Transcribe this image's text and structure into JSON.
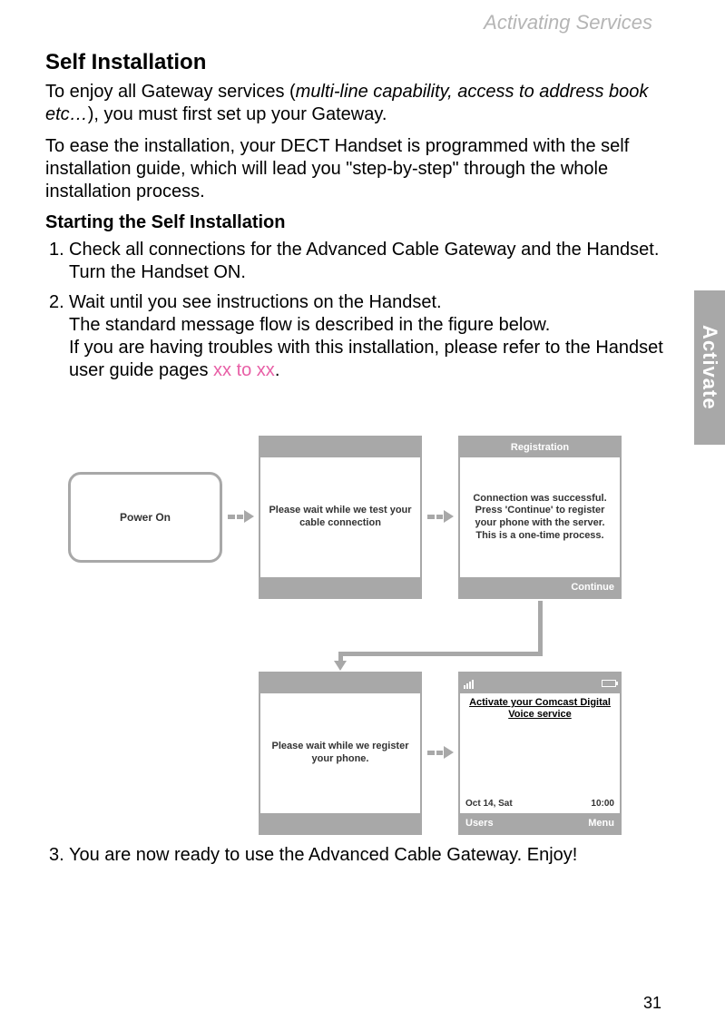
{
  "header": {
    "section_label": "Activating Services"
  },
  "side_tab": "Activate",
  "title": "Self Installation",
  "intro1_a": "To enjoy all Gateway services (",
  "intro1_b": "multi-line capability, access to address book etc…",
  "intro1_c": "), you must first set up your Gateway.",
  "intro2": "To ease the installation, your DECT Handset is programmed with the self installation guide, which will lead you \"step-by-step\" through the whole installation process.",
  "subheading": "Starting the Self Installation",
  "steps": {
    "s1": "Check all connections for the Advanced Cable Gateway and the Handset. Turn the Handset ON.",
    "s2a": "Wait until you see instructions on the Handset.",
    "s2b": "The standard message flow is described in the figure below.",
    "s2c": "If you are having troubles with this installation, please refer to the Handset user guide pages ",
    "s2d": "xx to xx",
    "s2e": ".",
    "s3": "You are now ready to use the Advanced Cable Gateway. Enjoy!"
  },
  "diagram": {
    "power_on": "Power On",
    "screen1_body": "Please wait while we test your cable connection",
    "screen2_title": "Registration",
    "screen2_body": "Connection was successful. Press 'Continue' to register your phone with the server. This is a one-time process.",
    "screen2_footer": "Continue",
    "screen3_body": "Please wait while we register your phone.",
    "screen4_activate": "Activate your Comcast Digital Voice service",
    "screen4_date": "Oct 14, Sat",
    "screen4_time": "10:00",
    "screen4_left": "Users",
    "screen4_right": "Menu"
  },
  "page_number": "31"
}
